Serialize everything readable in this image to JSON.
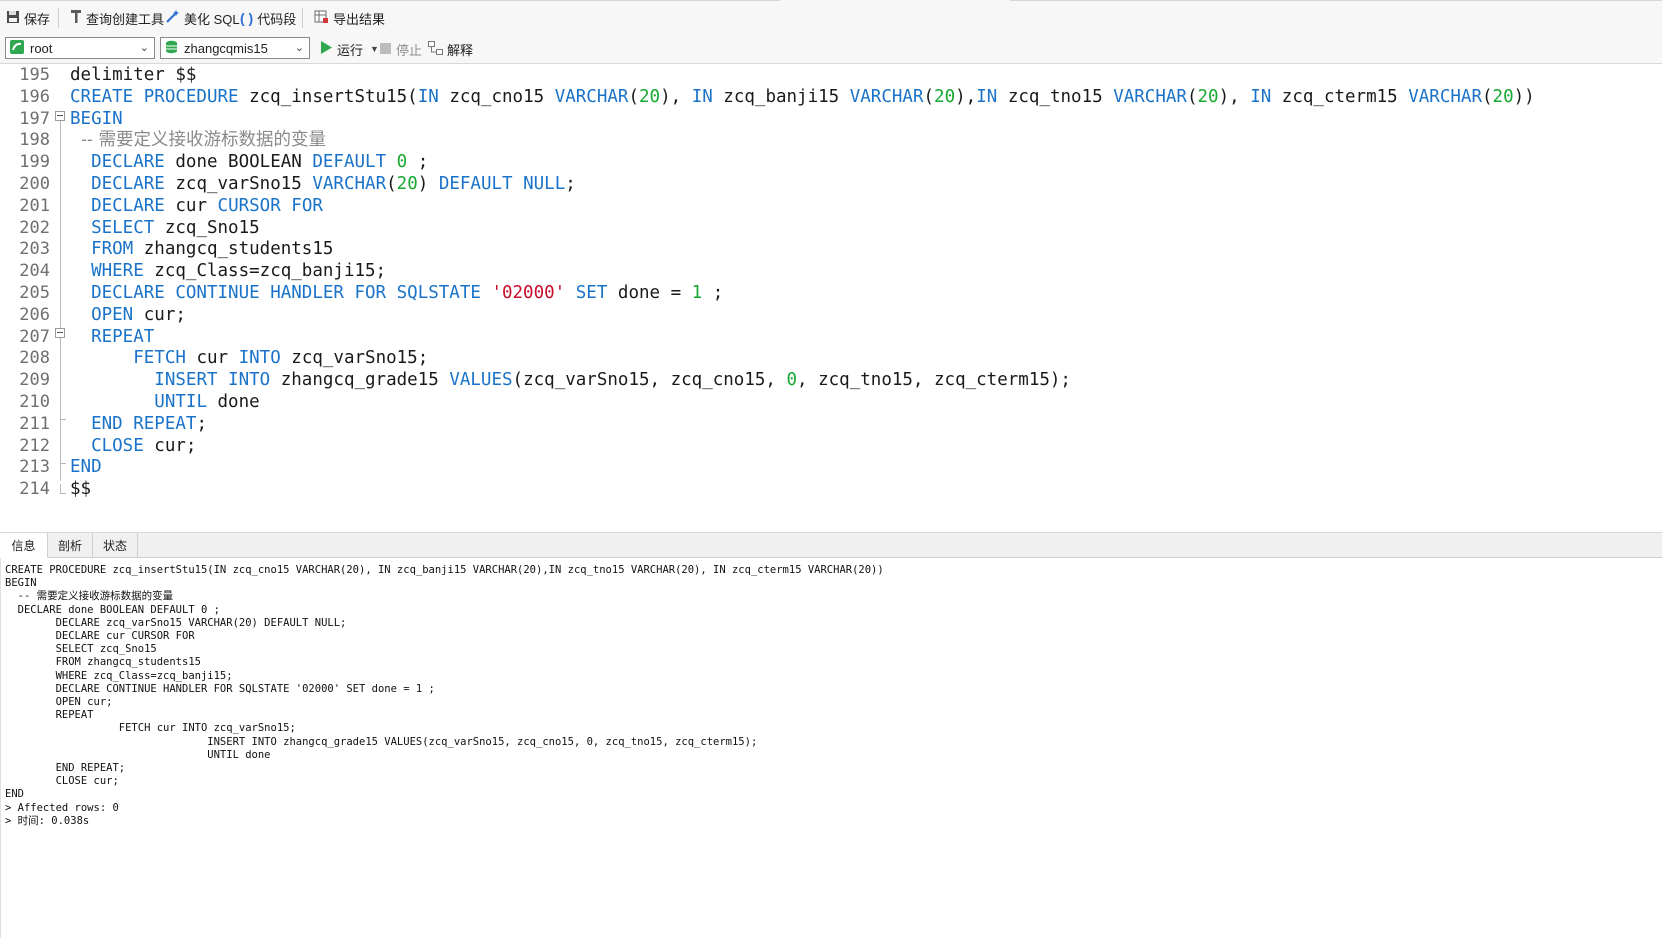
{
  "toolbar": {
    "save": "保存",
    "query_builder": "查询创建工具",
    "beautify_sql": "美化 SQL",
    "code_snippet": "代码段",
    "export_results": "导出结果"
  },
  "connection": {
    "user": "root",
    "database": "zhangcqmis15",
    "run": "运行",
    "stop": "停止",
    "explain": "解释"
  },
  "editor": {
    "lines": [
      {
        "no": "195",
        "tokens": [
          {
            "t": "delimiter $$",
            "c": ""
          }
        ]
      },
      {
        "no": "196",
        "tokens": [
          {
            "t": "CREATE PROCEDURE",
            "c": "kw"
          },
          {
            "t": " zcq_insertStu15(",
            "c": ""
          },
          {
            "t": "IN",
            "c": "kw"
          },
          {
            "t": " zcq_cno15 ",
            "c": ""
          },
          {
            "t": "VARCHAR",
            "c": "kw"
          },
          {
            "t": "(",
            "c": ""
          },
          {
            "t": "20",
            "c": "num"
          },
          {
            "t": "), ",
            "c": ""
          },
          {
            "t": "IN",
            "c": "kw"
          },
          {
            "t": " zcq_banji15 ",
            "c": ""
          },
          {
            "t": "VARCHAR",
            "c": "kw"
          },
          {
            "t": "(",
            "c": ""
          },
          {
            "t": "20",
            "c": "num"
          },
          {
            "t": "),",
            "c": ""
          },
          {
            "t": "IN",
            "c": "kw"
          },
          {
            "t": " zcq_tno15 ",
            "c": ""
          },
          {
            "t": "VARCHAR",
            "c": "kw"
          },
          {
            "t": "(",
            "c": ""
          },
          {
            "t": "20",
            "c": "num"
          },
          {
            "t": "), ",
            "c": ""
          },
          {
            "t": "IN",
            "c": "kw"
          },
          {
            "t": " zcq_cterm15 ",
            "c": ""
          },
          {
            "t": "VARCHAR",
            "c": "kw"
          },
          {
            "t": "(",
            "c": ""
          },
          {
            "t": "20",
            "c": "num"
          },
          {
            "t": "))",
            "c": ""
          }
        ]
      },
      {
        "no": "197",
        "tokens": [
          {
            "t": "BEGIN",
            "c": "kw"
          }
        ]
      },
      {
        "no": "198",
        "tokens": [
          {
            "t": "  -- 需要定义接收游标数据的变量",
            "c": "cmt"
          }
        ]
      },
      {
        "no": "199",
        "tokens": [
          {
            "t": "  ",
            "c": ""
          },
          {
            "t": "DECLARE",
            "c": "kw"
          },
          {
            "t": " done BOOLEAN ",
            "c": ""
          },
          {
            "t": "DEFAULT",
            "c": "kw"
          },
          {
            "t": " ",
            "c": ""
          },
          {
            "t": "0",
            "c": "num"
          },
          {
            "t": " ;",
            "c": ""
          }
        ]
      },
      {
        "no": "200",
        "tokens": [
          {
            "t": "  ",
            "c": ""
          },
          {
            "t": "DECLARE",
            "c": "kw"
          },
          {
            "t": " zcq_varSno15 ",
            "c": ""
          },
          {
            "t": "VARCHAR",
            "c": "kw"
          },
          {
            "t": "(",
            "c": ""
          },
          {
            "t": "20",
            "c": "num"
          },
          {
            "t": ") ",
            "c": ""
          },
          {
            "t": "DEFAULT NULL",
            "c": "kw"
          },
          {
            "t": ";",
            "c": ""
          }
        ]
      },
      {
        "no": "201",
        "tokens": [
          {
            "t": "  ",
            "c": ""
          },
          {
            "t": "DECLARE",
            "c": "kw"
          },
          {
            "t": " cur ",
            "c": ""
          },
          {
            "t": "CURSOR FOR",
            "c": "kw"
          }
        ]
      },
      {
        "no": "202",
        "tokens": [
          {
            "t": "  ",
            "c": ""
          },
          {
            "t": "SELECT",
            "c": "kw"
          },
          {
            "t": " zcq_Sno15",
            "c": ""
          }
        ]
      },
      {
        "no": "203",
        "tokens": [
          {
            "t": "  ",
            "c": ""
          },
          {
            "t": "FROM",
            "c": "kw"
          },
          {
            "t": " zhangcq_students15",
            "c": ""
          }
        ]
      },
      {
        "no": "204",
        "tokens": [
          {
            "t": "  ",
            "c": ""
          },
          {
            "t": "WHERE",
            "c": "kw"
          },
          {
            "t": " zcq_Class=zcq_banji15;",
            "c": ""
          }
        ]
      },
      {
        "no": "205",
        "tokens": [
          {
            "t": "  ",
            "c": ""
          },
          {
            "t": "DECLARE CONTINUE HANDLER FOR SQLSTATE",
            "c": "kw"
          },
          {
            "t": " ",
            "c": ""
          },
          {
            "t": "'02000'",
            "c": "str"
          },
          {
            "t": " ",
            "c": ""
          },
          {
            "t": "SET",
            "c": "kw"
          },
          {
            "t": " done = ",
            "c": ""
          },
          {
            "t": "1",
            "c": "num"
          },
          {
            "t": " ;",
            "c": ""
          }
        ]
      },
      {
        "no": "206",
        "tokens": [
          {
            "t": "  ",
            "c": ""
          },
          {
            "t": "OPEN",
            "c": "kw"
          },
          {
            "t": " cur;",
            "c": ""
          }
        ]
      },
      {
        "no": "207",
        "tokens": [
          {
            "t": "  ",
            "c": ""
          },
          {
            "t": "REPEAT",
            "c": "kw"
          }
        ]
      },
      {
        "no": "208",
        "tokens": [
          {
            "t": "      ",
            "c": ""
          },
          {
            "t": "FETCH",
            "c": "kw"
          },
          {
            "t": " cur ",
            "c": ""
          },
          {
            "t": "INTO",
            "c": "kw"
          },
          {
            "t": " zcq_varSno15;",
            "c": ""
          }
        ]
      },
      {
        "no": "209",
        "tokens": [
          {
            "t": "        ",
            "c": ""
          },
          {
            "t": "INSERT INTO",
            "c": "kw"
          },
          {
            "t": " zhangcq_grade15 ",
            "c": ""
          },
          {
            "t": "VALUES",
            "c": "kw"
          },
          {
            "t": "(zcq_varSno15, zcq_cno15, ",
            "c": ""
          },
          {
            "t": "0",
            "c": "num"
          },
          {
            "t": ", zcq_tno15, zcq_cterm15);",
            "c": ""
          }
        ]
      },
      {
        "no": "210",
        "tokens": [
          {
            "t": "        ",
            "c": ""
          },
          {
            "t": "UNTIL",
            "c": "kw"
          },
          {
            "t": " done",
            "c": ""
          }
        ]
      },
      {
        "no": "211",
        "tokens": [
          {
            "t": "  ",
            "c": ""
          },
          {
            "t": "END REPEAT",
            "c": "kw"
          },
          {
            "t": ";",
            "c": ""
          }
        ]
      },
      {
        "no": "212",
        "tokens": [
          {
            "t": "  ",
            "c": ""
          },
          {
            "t": "CLOSE",
            "c": "kw"
          },
          {
            "t": " cur;",
            "c": ""
          }
        ]
      },
      {
        "no": "213",
        "tokens": [
          {
            "t": "END",
            "c": "kw"
          }
        ]
      },
      {
        "no": "214",
        "tokens": [
          {
            "t": "$$",
            "c": ""
          }
        ]
      }
    ]
  },
  "tabs": [
    "信息",
    "剖析",
    "状态"
  ],
  "output": {
    "lines": [
      "CREATE PROCEDURE zcq_insertStu15(IN zcq_cno15 VARCHAR(20), IN zcq_banji15 VARCHAR(20),IN zcq_tno15 VARCHAR(20), IN zcq_cterm15 VARCHAR(20))",
      "BEGIN",
      "  -- 需要定义接收游标数据的变量",
      "  DECLARE done BOOLEAN DEFAULT 0 ;",
      "        DECLARE zcq_varSno15 VARCHAR(20) DEFAULT NULL;",
      "        DECLARE cur CURSOR FOR",
      "        SELECT zcq_Sno15",
      "        FROM zhangcq_students15",
      "        WHERE zcq_Class=zcq_banji15;",
      "        DECLARE CONTINUE HANDLER FOR SQLSTATE '02000' SET done = 1 ;",
      "        OPEN cur;",
      "        REPEAT",
      "                  FETCH cur INTO zcq_varSno15;",
      "                                INSERT INTO zhangcq_grade15 VALUES(zcq_varSno15, zcq_cno15, 0, zcq_tno15, zcq_cterm15);",
      "                                UNTIL done",
      "        END REPEAT;",
      "        CLOSE cur;",
      "END",
      "> Affected rows: 0",
      "> 时间: 0.038s"
    ]
  },
  "colors": {
    "keyword": "#1a73c9",
    "number": "#17a832",
    "string": "#c8102e",
    "comment": "#8a8a8a"
  },
  "icons": {
    "save": "save-icon",
    "query_builder": "query-builder-icon",
    "beautify": "magic-wand-icon",
    "snippet": "parentheses-icon",
    "export": "export-icon",
    "connection": "connection-icon",
    "database": "database-icon",
    "run": "play-icon",
    "stop": "stop-icon",
    "explain": "explain-icon"
  }
}
